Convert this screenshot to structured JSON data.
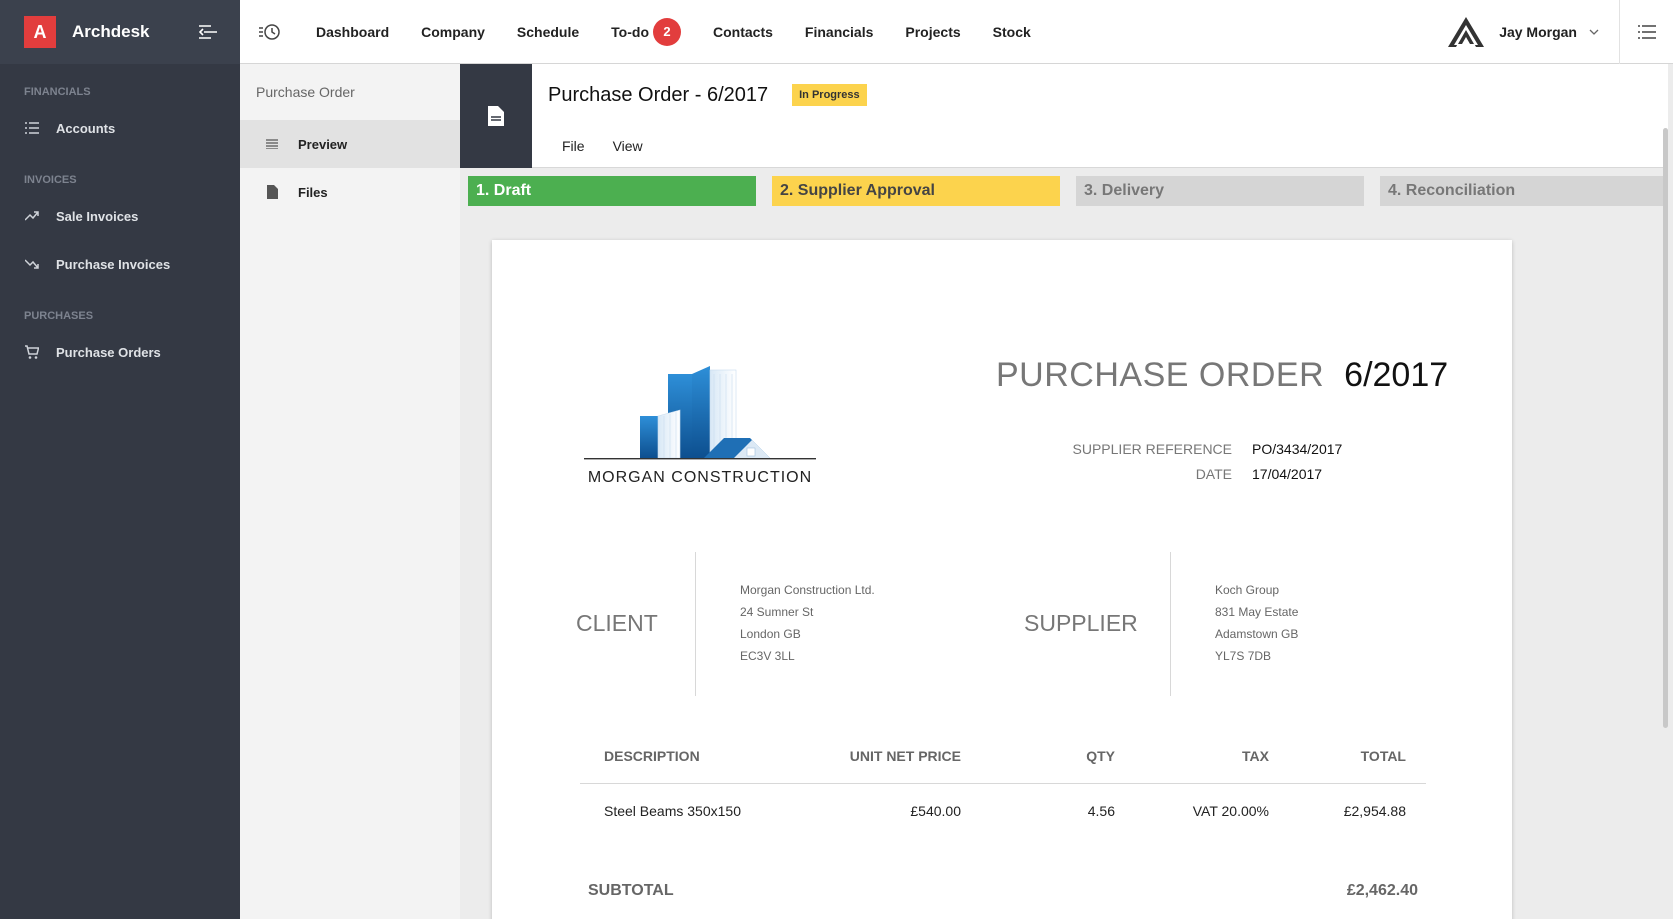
{
  "brand": {
    "logo_letter": "A",
    "name": "Archdesk",
    "color": "#e23d3d"
  },
  "sidebar": {
    "sections": [
      {
        "title": "FINANCIALS",
        "items": [
          {
            "label": "Accounts",
            "icon": "list-icon"
          }
        ]
      },
      {
        "title": "INVOICES",
        "items": [
          {
            "label": "Sale Invoices",
            "icon": "trending-up-icon"
          },
          {
            "label": "Purchase Invoices",
            "icon": "trending-down-icon"
          }
        ]
      },
      {
        "title": "PURCHASES",
        "items": [
          {
            "label": "Purchase Orders",
            "icon": "cart-icon"
          }
        ]
      }
    ]
  },
  "topnav": {
    "items": [
      "Dashboard",
      "Company",
      "Schedule",
      "To-do",
      "Contacts",
      "Financials",
      "Projects",
      "Stock"
    ],
    "todo_count": "2",
    "user_name": "Jay Morgan"
  },
  "subpanel": {
    "title": "Purchase Order",
    "items": [
      {
        "label": "Preview",
        "icon": "lines-icon",
        "active": true
      },
      {
        "label": "Files",
        "icon": "file-icon",
        "active": false
      }
    ]
  },
  "document": {
    "title": "Purchase Order - 6/2017",
    "status": "In Progress",
    "menu": [
      "File",
      "View"
    ],
    "steps": [
      "1. Draft",
      "2. Supplier Approval",
      "3. Delivery",
      "4. Reconciliation"
    ]
  },
  "po": {
    "company_name": "MORGAN CONSTRUCTION",
    "heading_label": "PURCHASE ORDER",
    "number": "6/2017",
    "meta": [
      {
        "key": "SUPPLIER REFERENCE",
        "value": "PO/3434/2017"
      },
      {
        "key": "DATE",
        "value": "17/04/2017"
      }
    ],
    "client_label": "CLIENT",
    "client_address": [
      "Morgan Construction Ltd.",
      "24 Sumner St",
      "London GB",
      "EC3V 3LL"
    ],
    "supplier_label": "SUPPLIER",
    "supplier_address": [
      "Koch Group",
      "831 May Estate",
      "Adamstown GB",
      "YL7S 7DB"
    ],
    "table": {
      "headers": [
        "DESCRIPTION",
        "UNIT NET PRICE",
        "QTY",
        "TAX",
        "TOTAL"
      ],
      "rows": [
        [
          "Steel Beams 350x150",
          "£540.00",
          "4.56",
          "VAT 20.00%",
          "£2,954.88"
        ]
      ]
    },
    "subtotal_label": "SUBTOTAL",
    "subtotal_value": "£2,462.40"
  }
}
